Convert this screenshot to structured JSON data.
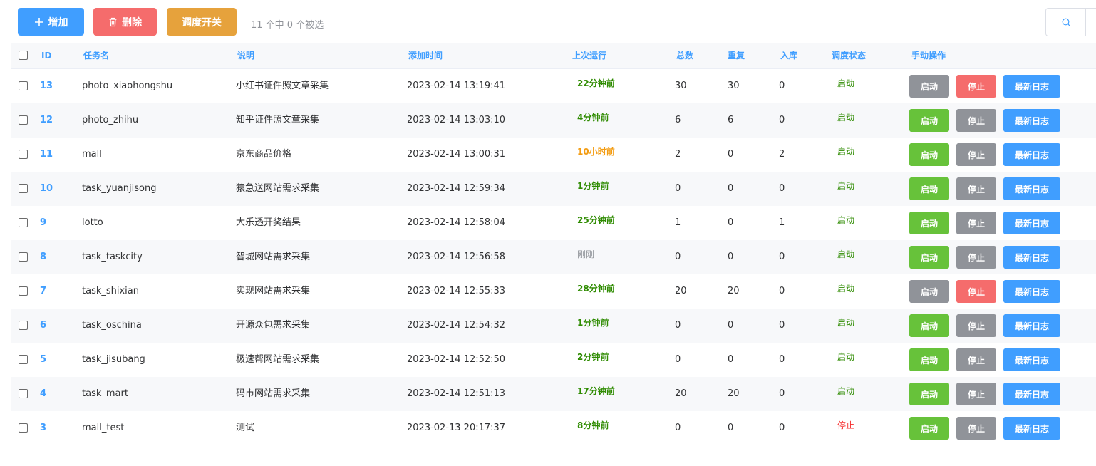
{
  "colors": {
    "primary": "#409eff",
    "danger": "#f56c6c",
    "warning": "#e6a23c",
    "success": "#67c23a",
    "info": "#909399",
    "green_text": "#2e8b00",
    "orange_text": "#f39c12",
    "red_text": "#f52d2d",
    "gray_text": "#909399"
  },
  "toolbar": {
    "add_label": "增加",
    "add_icon": "plus-icon",
    "delete_label": "删除",
    "delete_icon": "trash-icon",
    "schedule_label": "调度开关",
    "selection_info": "11 个中 0 个被选",
    "search_icon": "search-icon"
  },
  "table": {
    "headers": {
      "id": "ID",
      "name": "任务名",
      "desc": "说明",
      "added": "添加时间",
      "last_run": "上次运行",
      "total": "总数",
      "dup": "重复",
      "stored": "入库",
      "status": "调度状态",
      "actions": "手动操作"
    },
    "action_labels": {
      "start": "启动",
      "stop": "停止",
      "log": "最新日志"
    },
    "rows": [
      {
        "id": "13",
        "name": "photo_xiaohongshu",
        "desc": "小红书证件照文章采集",
        "added": "2023-02-14 13:19:41",
        "last_run": "22分钟前",
        "last_color": "green",
        "total": "30",
        "dup": "30",
        "stored": "0",
        "status": "启动",
        "status_color": "green",
        "running": true
      },
      {
        "id": "12",
        "name": "photo_zhihu",
        "desc": "知乎证件照文章采集",
        "added": "2023-02-14 13:03:10",
        "last_run": "4分钟前",
        "last_color": "green",
        "total": "6",
        "dup": "6",
        "stored": "0",
        "status": "启动",
        "status_color": "green",
        "running": false
      },
      {
        "id": "11",
        "name": "mall",
        "desc": "京东商品价格",
        "added": "2023-02-14 13:00:31",
        "last_run": "10小时前",
        "last_color": "orange",
        "total": "2",
        "dup": "0",
        "stored": "2",
        "status": "启动",
        "status_color": "green",
        "running": false
      },
      {
        "id": "10",
        "name": "task_yuanjisong",
        "desc": "猿急送网站需求采集",
        "added": "2023-02-14 12:59:34",
        "last_run": "1分钟前",
        "last_color": "green",
        "total": "0",
        "dup": "0",
        "stored": "0",
        "status": "启动",
        "status_color": "green",
        "running": false
      },
      {
        "id": "9",
        "name": "lotto",
        "desc": "大乐透开奖结果",
        "added": "2023-02-14 12:58:04",
        "last_run": "25分钟前",
        "last_color": "green",
        "total": "1",
        "dup": "0",
        "stored": "1",
        "status": "启动",
        "status_color": "green",
        "running": false
      },
      {
        "id": "8",
        "name": "task_taskcity",
        "desc": "智城网站需求采集",
        "added": "2023-02-14 12:56:58",
        "last_run": "刚刚",
        "last_color": "gray",
        "total": "0",
        "dup": "0",
        "stored": "0",
        "status": "启动",
        "status_color": "green",
        "running": false
      },
      {
        "id": "7",
        "name": "task_shixian",
        "desc": "实现网站需求采集",
        "added": "2023-02-14 12:55:33",
        "last_run": "28分钟前",
        "last_color": "green",
        "total": "20",
        "dup": "20",
        "stored": "0",
        "status": "启动",
        "status_color": "green",
        "running": true
      },
      {
        "id": "6",
        "name": "task_oschina",
        "desc": "开源众包需求采集",
        "added": "2023-02-14 12:54:32",
        "last_run": "1分钟前",
        "last_color": "green",
        "total": "0",
        "dup": "0",
        "stored": "0",
        "status": "启动",
        "status_color": "green",
        "running": false
      },
      {
        "id": "5",
        "name": "task_jisubang",
        "desc": "极速帮网站需求采集",
        "added": "2023-02-14 12:52:50",
        "last_run": "2分钟前",
        "last_color": "green",
        "total": "0",
        "dup": "0",
        "stored": "0",
        "status": "启动",
        "status_color": "green",
        "running": false
      },
      {
        "id": "4",
        "name": "task_mart",
        "desc": "码市网站需求采集",
        "added": "2023-02-14 12:51:13",
        "last_run": "17分钟前",
        "last_color": "green",
        "total": "20",
        "dup": "20",
        "stored": "0",
        "status": "启动",
        "status_color": "green",
        "running": false
      },
      {
        "id": "3",
        "name": "mall_test",
        "desc": "测试",
        "added": "2023-02-13 20:17:37",
        "last_run": "8分钟前",
        "last_color": "green",
        "total": "0",
        "dup": "0",
        "stored": "0",
        "status": "停止",
        "status_color": "red",
        "running": false
      }
    ]
  }
}
